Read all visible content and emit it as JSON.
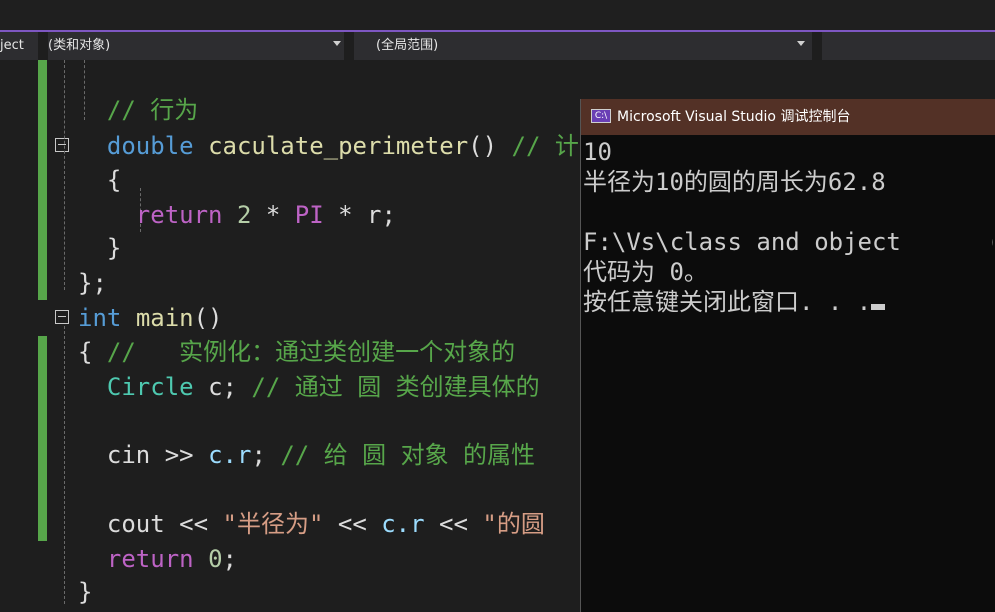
{
  "nav": {
    "project_fragment": "ject",
    "class_scope": "(类和对象)",
    "global_scope": "(全局范围)"
  },
  "code": {
    "comment_behavior": "// 行为",
    "kw_double": "double",
    "fn_perimeter": "caculate_perimeter",
    "parens": "()",
    "comment_perimeter_trunc": "// 计",
    "open_brace": "{",
    "kw_return": "return",
    "num_2": "2",
    "op_mul": "*",
    "macro_pi": "PI",
    "var_r": "r",
    "semicolon": ";",
    "close_brace": "}",
    "close_brace_semi": "};",
    "kw_int": "int",
    "fn_main": "main",
    "comment_instantiate": "//   实例化：通过类创建一个对象的",
    "type_circle": "Circle",
    "var_c": "c",
    "comment_create": "// 通过 圆 类创建具体的",
    "kw_cin": "cin",
    "op_shr": ">>",
    "member_cr": "c.r",
    "comment_assign": "// 给 圆 对象 的属性",
    "kw_cout": "cout",
    "op_shl": "<<",
    "str_radius": "\"半径为\"",
    "str_circle_trunc": "\"的圆",
    "num_0": "0"
  },
  "console": {
    "title": "Microsoft Visual Studio 调试控制台",
    "icon_label": "C:\\",
    "lines": [
      "10",
      "半径为10的圆的周长为62.8",
      "",
      "F:\\Vs\\class and object      (",
      "代码为 0。",
      "按任意键关闭此窗口. . ."
    ]
  }
}
